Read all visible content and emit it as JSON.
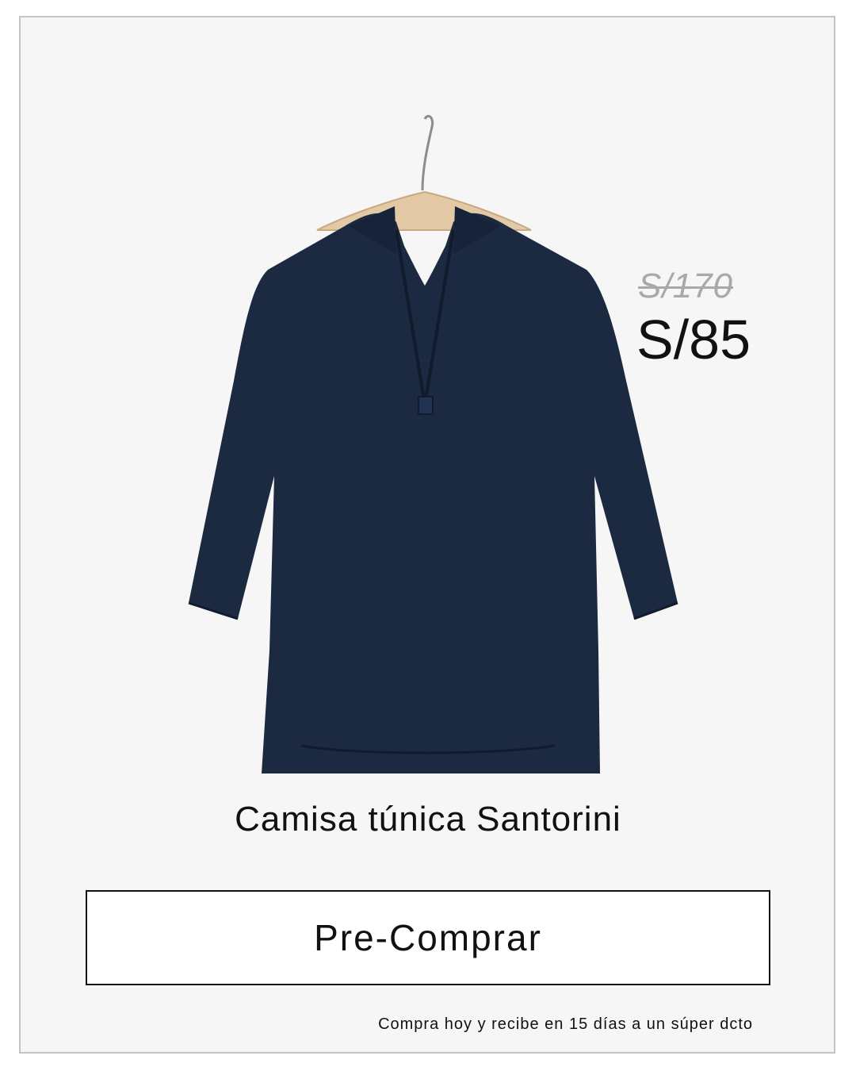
{
  "product": {
    "title": "Camisa túnica Santorini",
    "old_price": "S/170",
    "new_price": "S/85",
    "image_icon": "navy-tunic-shirt-on-hanger",
    "shirt_color": "#1b2a41"
  },
  "cta": {
    "label": "Pre-Comprar"
  },
  "promo": {
    "note": "Compra hoy y recibe en 15 días a un súper dcto"
  },
  "colors": {
    "background": "#f6f6f6",
    "frame": "#c4c4c4",
    "strikethrough_price": "#a9a9a9",
    "text": "#111111"
  }
}
